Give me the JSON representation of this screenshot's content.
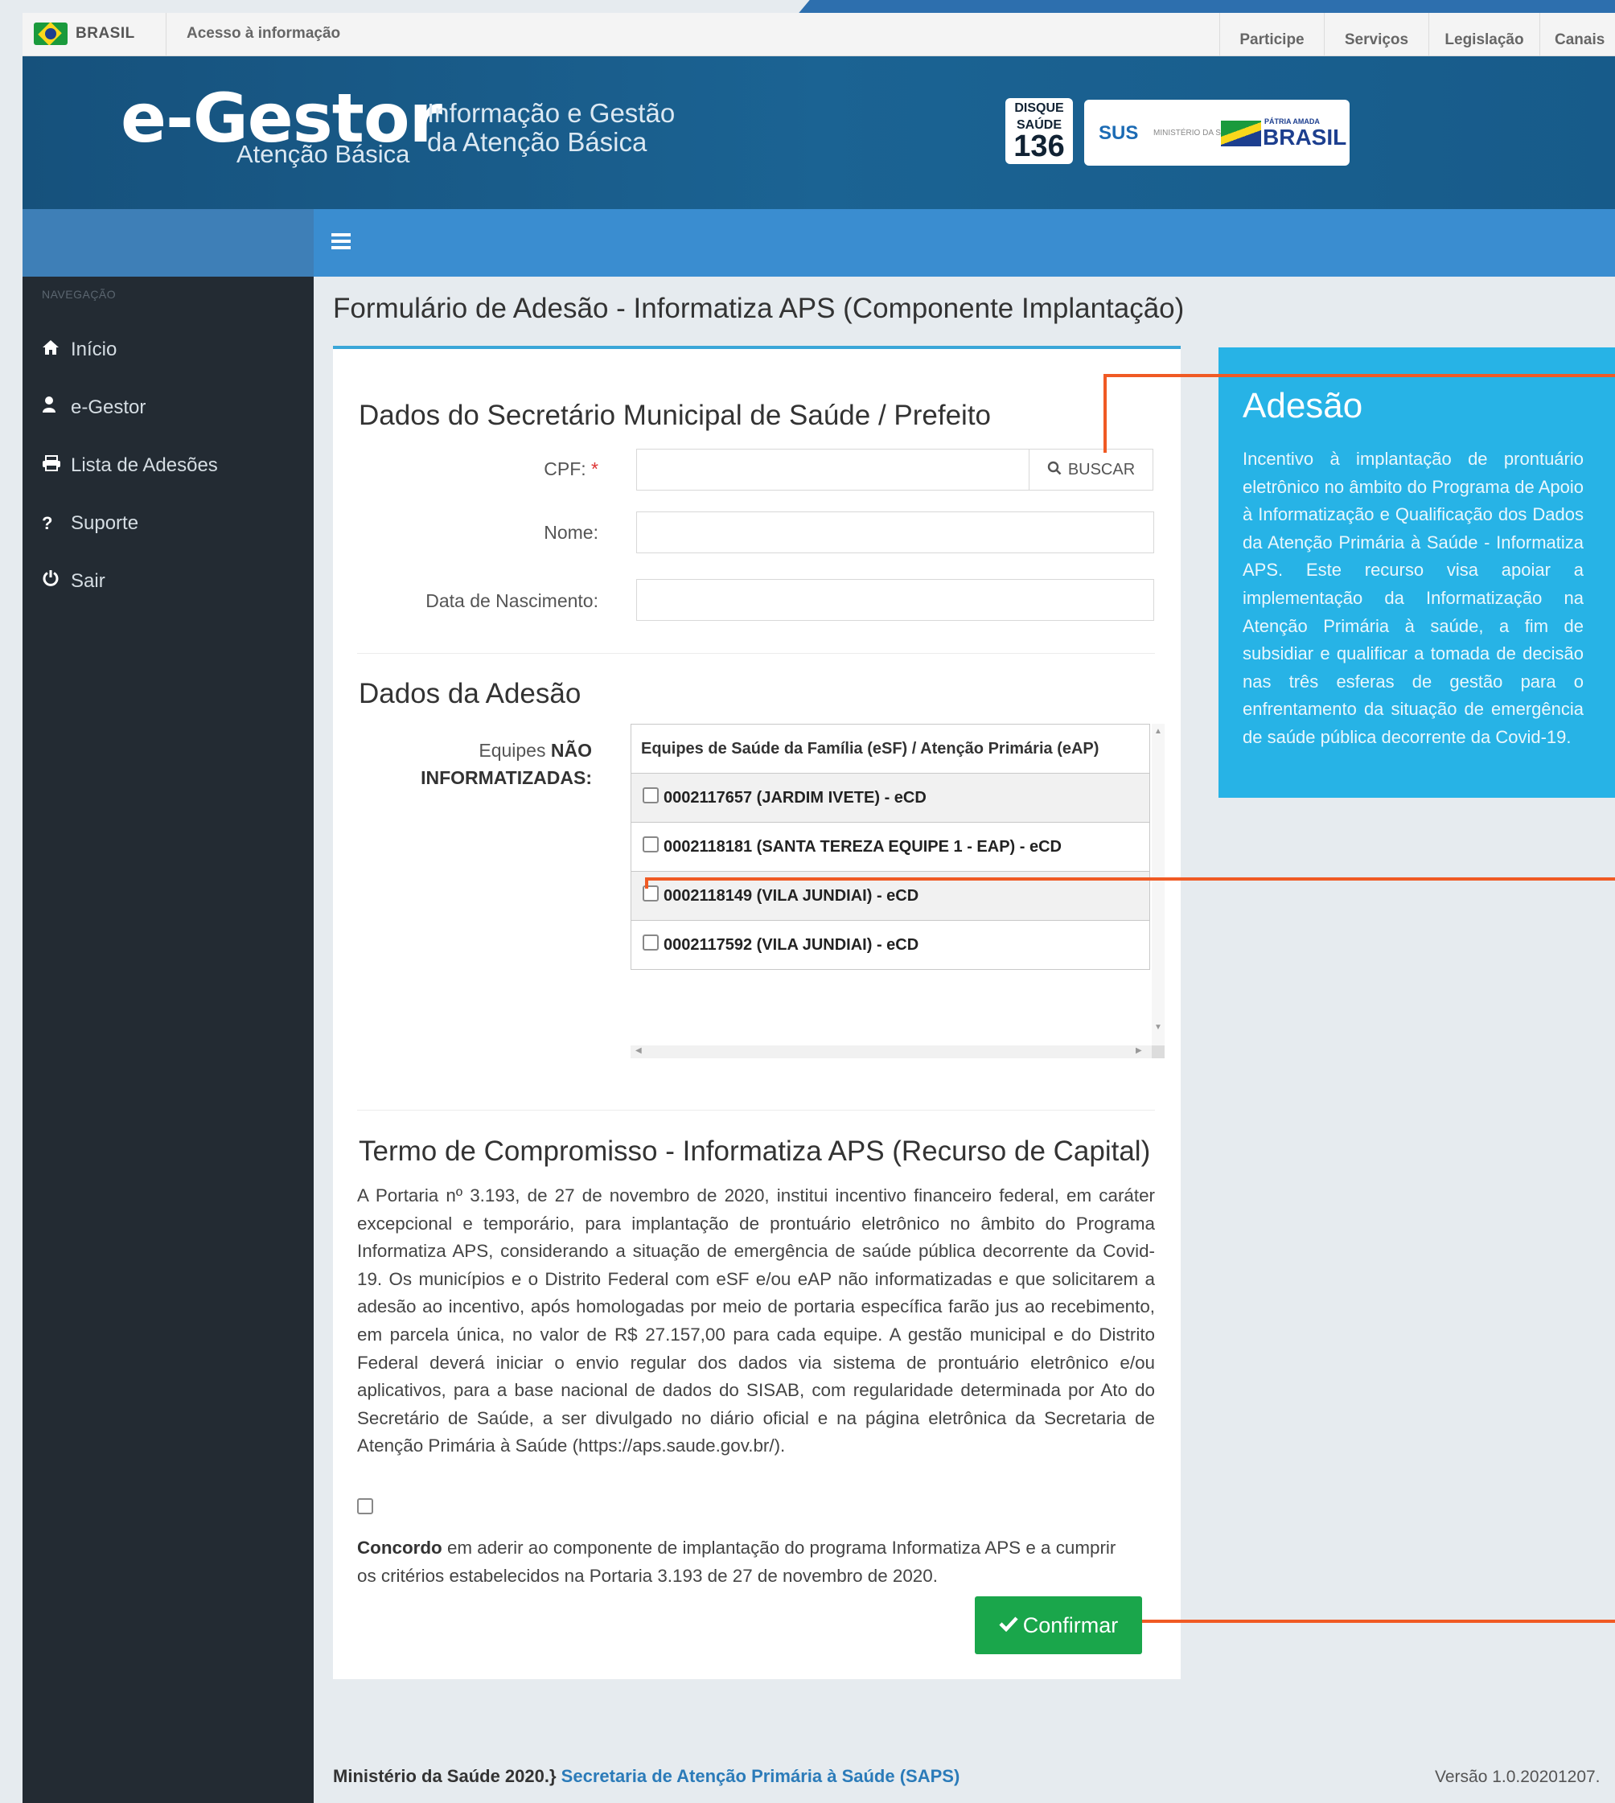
{
  "gov_bar": {
    "country": "BRASIL",
    "access_link": "Acesso à informação",
    "links": [
      "Participe",
      "Serviços",
      "Legislação",
      "Canais"
    ]
  },
  "header": {
    "logo_main": "e-Gestor",
    "logo_sub": "Atenção Básica",
    "desc_line1": "Informação e Gestão",
    "desc_line2": "da Atenção Básica",
    "disque_line1": "DISQUE",
    "disque_line2": "SAÚDE",
    "disque_number": "136",
    "partner_sus": "SUS",
    "partner_ms": "MINISTÉRIO DA SAÚDE",
    "partner_brasil_small": "PÁTRIA AMADA",
    "partner_brasil": "BRASIL"
  },
  "sidebar": {
    "title": "NAVEGAÇÃO",
    "items": [
      {
        "label": "Início",
        "icon": "home-icon"
      },
      {
        "label": "e-Gestor",
        "icon": "user-icon"
      },
      {
        "label": "Lista de Adesões",
        "icon": "print-icon"
      },
      {
        "label": "Suporte",
        "icon": "question-icon"
      },
      {
        "label": "Sair",
        "icon": "power-icon"
      }
    ]
  },
  "page": {
    "title": "Formulário de Adesão - Informatiza APS (Componente Implantação)"
  },
  "secretario": {
    "heading": "Dados do Secretário Municipal de Saúde / Prefeito",
    "cpf_label": "CPF:",
    "cpf_required": "*",
    "cpf_value": "",
    "buscar_label": "BUSCAR",
    "nome_label": "Nome:",
    "nome_value": "",
    "nascimento_label": "Data de Nascimento:",
    "nascimento_value": ""
  },
  "adesao": {
    "heading": "Dados da Adesão",
    "equipes_label_1": "Equipes",
    "equipes_label_2": "NÃO",
    "equipes_label_3": "INFORMATIZADAS:",
    "table_header": "Equipes de Saúde da Família (eSF) / Atenção Primária (eAP)",
    "rows": [
      "0002117657 (JARDIM IVETE) - eCD",
      "0002118181 (SANTA TEREZA EQUIPE 1 - EAP) - eCD",
      "0002118149 (VILA JUNDIAI) - eCD",
      "0002117592 (VILA JUNDIAI) - eCD"
    ]
  },
  "termo": {
    "heading": "Termo de Compromisso - Informatiza APS (Recurso de Capital)",
    "body": "A Portaria nº 3.193, de 27 de novembro de 2020, institui incentivo financeiro federal, em caráter excepcional e temporário, para implantação de prontuário eletrônico no âmbito do Programa Informatiza APS, considerando a situação de emergência de saúde pública decorrente da Covid-19. Os municípios e o Distrito Federal com eSF e/ou eAP não informatizadas e que solicitarem a adesão ao incentivo, após homologadas por meio de portaria específica farão jus ao recebimento, em parcela única, no valor de R$ 27.157,00 para cada equipe. A gestão municipal e do Distrito Federal deverá iniciar o envio regular dos dados via sistema de prontuário eletrônico e/ou aplicativos, para a base nacional de dados do SISAB, com regularidade determinada por Ato do Secretário de Saúde, a ser divulgado no diário oficial e na página eletrônica da Secretaria de Atenção Primária à Saúde (https://aps.saude.gov.br/).",
    "agree_strong": "Concordo",
    "agree_text": " em aderir ao componente de implantação do programa Informatiza APS e a cumprir os critérios estabelecidos na Portaria 3.193 de 27 de novembro de 2020.",
    "confirm_label": "Confirmar"
  },
  "info_box": {
    "title": "Adesão",
    "text": "Incentivo à implantação de prontuário eletrônico no âmbito do Programa de Apoio à Informatização e Qualificação dos Dados da Atenção Primária à Saúde - Informatiza APS. Este recurso visa apoiar a implementação da Informatização na Atenção Primária à saúde, a fim de subsidiar e qualificar a tomada de decisão nas três esferas de gestão para o enfrentamento da situação de emergência de saúde pública decorrente da Covid-19."
  },
  "footer": {
    "left": "Ministério da Saúde 2020.}",
    "link": "Secretaria de Atenção Primária à Saúde (SAPS)",
    "version": "Versão 1.0.20201207."
  },
  "colors": {
    "header": "#1b6393",
    "toolbar": "#3a8dd0",
    "sidebar": "#232b33",
    "accent": "#27b3e6",
    "confirm": "#1aa64b",
    "annotation": "#f05a24"
  }
}
